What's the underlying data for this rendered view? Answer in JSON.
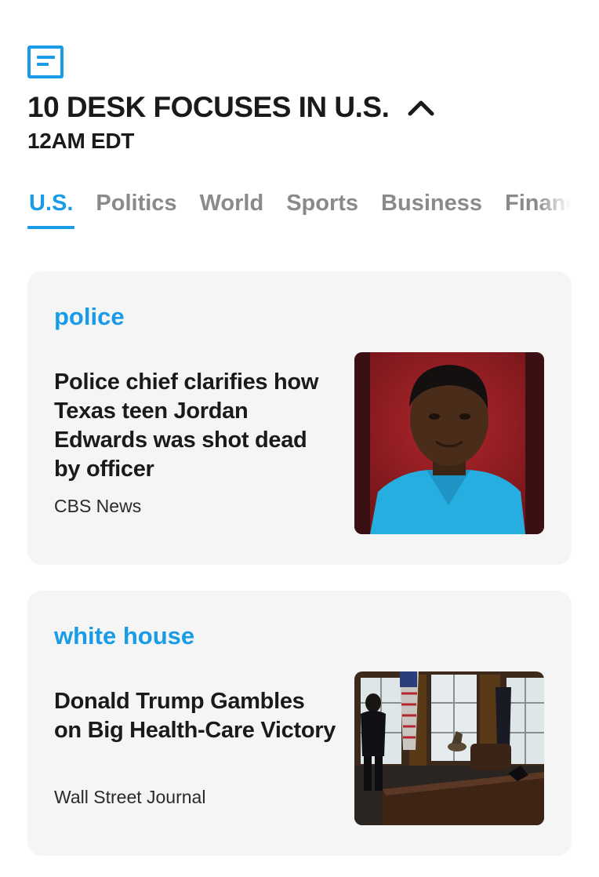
{
  "header": {
    "menu_icon": "menu-icon",
    "title": "10 DESK FOCUSES IN U.S.",
    "collapse_icon": "chevron-up-icon",
    "time": "12AM EDT"
  },
  "tabs": [
    {
      "label": "U.S.",
      "active": true
    },
    {
      "label": "Politics",
      "active": false
    },
    {
      "label": "World",
      "active": false
    },
    {
      "label": "Sports",
      "active": false
    },
    {
      "label": "Business",
      "active": false
    },
    {
      "label": "Finance",
      "active": false
    }
  ],
  "cards": [
    {
      "topic": "police",
      "headline": "Police chief clarifies how Texas teen Jordan Edwards was shot dead by officer",
      "source": "CBS News"
    },
    {
      "topic": "white house",
      "headline": "Donald Trump Gambles on Big Health-Care Victory",
      "source": "Wall Street Journal"
    }
  ],
  "colors": {
    "accent": "#1a9be8",
    "inactive_tab": "#8a8a8a",
    "card_background": "#f5f5f5",
    "text": "#1a1a1a"
  }
}
